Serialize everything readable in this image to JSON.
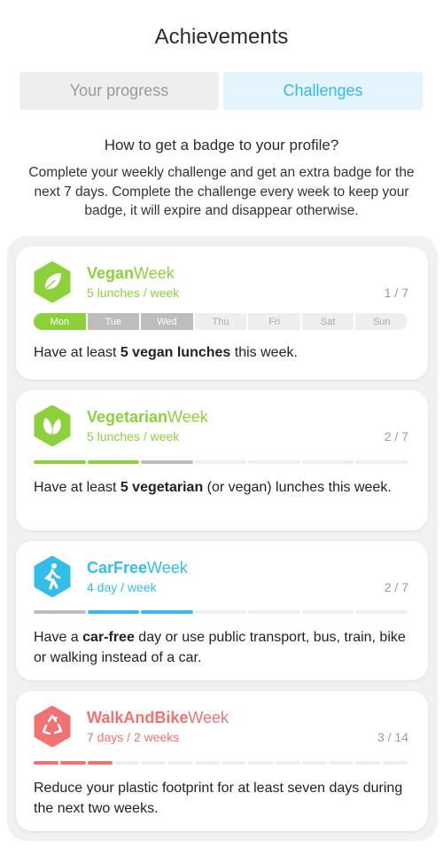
{
  "header": {
    "title": "Achievements"
  },
  "tabs": [
    {
      "label": "Your progress",
      "active": false
    },
    {
      "label": "Challenges",
      "active": true
    }
  ],
  "info": {
    "heading": "How to get a badge to your profile?",
    "body": "Complete your weekly challenge and get an extra badge for the next 7 days. Complete the challenge every week to keep your badge, it will expire and disappear otherwise."
  },
  "colors": {
    "green": "#8cd13c",
    "blue": "#33bde9",
    "red": "#f07373",
    "gray_segment": "#bdbdbd",
    "empty_segment": "#eeeeee"
  },
  "challenges": [
    {
      "name_bold": "Vegan",
      "name_rest": "Week",
      "subtitle": "5 lunches / week",
      "count": "1 / 7",
      "icon": "leaf-icon",
      "days": [
        {
          "label": "Mon",
          "state": "done"
        },
        {
          "label": "Tue",
          "state": "missed"
        },
        {
          "label": "Wed",
          "state": "missed"
        },
        {
          "label": "Thu",
          "state": "empty"
        },
        {
          "label": "Fri",
          "state": "empty"
        },
        {
          "label": "Sat",
          "state": "empty"
        },
        {
          "label": "Sun",
          "state": "empty"
        }
      ],
      "desc_pre": "Have at least ",
      "desc_bold": "5 vegan lunches",
      "desc_post": " this week."
    },
    {
      "name_bold": "Vegetarian",
      "name_rest": "Week",
      "subtitle": "5 lunches / week",
      "count": "2 / 7",
      "icon": "double-leaf-icon",
      "segments": [
        "done",
        "done",
        "missed",
        "empty",
        "empty",
        "empty",
        "empty"
      ],
      "desc_pre": "Have at least ",
      "desc_bold": "5 vegetarian",
      "desc_post": " (or vegan) lunches this week."
    },
    {
      "name_bold": "CarFree",
      "name_rest": "Week",
      "subtitle": "4 day / week",
      "count": "2 / 7",
      "icon": "walking-person-icon",
      "segments": [
        "missed",
        "done",
        "done",
        "empty",
        "empty",
        "empty",
        "empty"
      ],
      "desc_pre": "Have a ",
      "desc_bold": "car-free",
      "desc_post": " day or use public transport, bus, train, bike or walking instead of a car."
    },
    {
      "name_bold": "WalkAndBike",
      "name_rest": "Week",
      "subtitle": "7 days / 2 weeks",
      "count": "3 / 14",
      "icon": "recycle-icon",
      "segments": [
        "done",
        "done",
        "done",
        "empty",
        "empty",
        "empty",
        "empty",
        "empty",
        "empty",
        "empty",
        "empty",
        "empty",
        "empty",
        "empty"
      ],
      "desc_pre": "",
      "desc_bold": "",
      "desc_post": "Reduce your plastic footprint for at least seven days during the next two weeks."
    }
  ]
}
